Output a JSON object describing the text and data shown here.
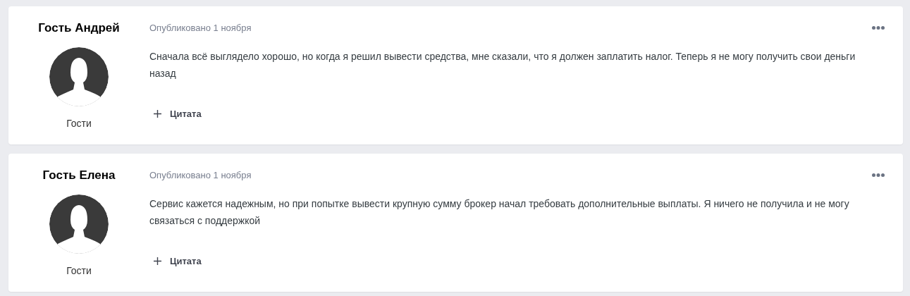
{
  "posts": [
    {
      "author": "Гость Андрей",
      "group": "Гости",
      "published": "Опубликовано 1 ноября",
      "text": "Сначала всё выглядело хорошо, но когда я решил вывести средства, мне сказали, что я должен заплатить налог. Теперь я не могу получить свои деньги назад",
      "quote": "Цитата"
    },
    {
      "author": "Гость Елена",
      "group": "Гости",
      "published": "Опубликовано 1 ноября",
      "text": "Сервис кажется надежным, но при попытке вывести крупную сумму брокер начал требовать дополнительные выплаты. Я ничего не получила и не могу связаться с поддержкой",
      "quote": "Цитата"
    }
  ]
}
